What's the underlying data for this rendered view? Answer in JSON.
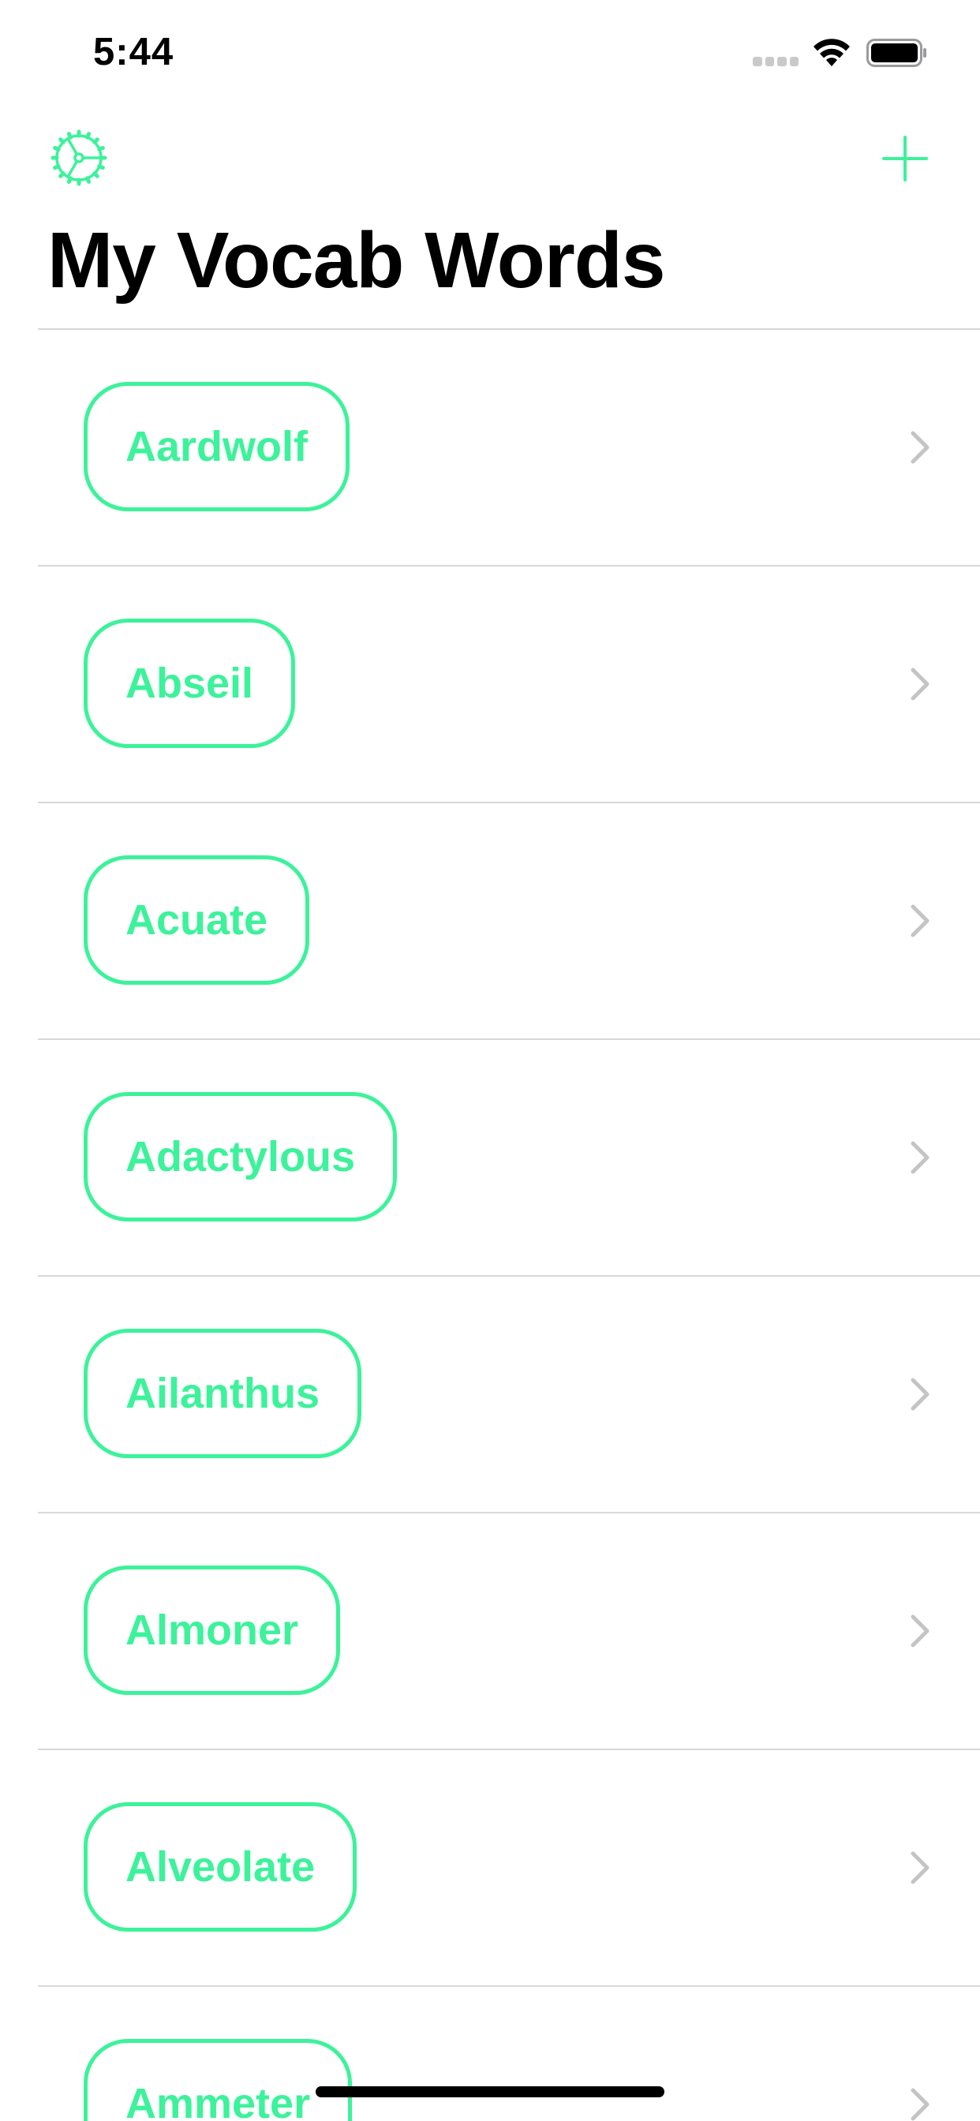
{
  "status_bar": {
    "time": "5:44"
  },
  "nav": {
    "settings_icon": "gear-icon",
    "add_icon": "plus-icon",
    "title": "My Vocab Words"
  },
  "colors": {
    "accent": "#3cf29a",
    "divider": "#d8d8dc",
    "chevron": "#c4c4c6"
  },
  "words": [
    "Aardwolf",
    "Abseil",
    "Acuate",
    "Adactylous",
    "Ailanthus",
    "Almoner",
    "Alveolate",
    "Ammeter"
  ]
}
